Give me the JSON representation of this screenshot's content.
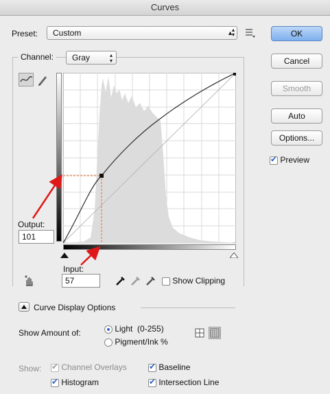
{
  "window": {
    "title": "Curves"
  },
  "preset": {
    "label": "Preset:",
    "value": "Custom"
  },
  "channel": {
    "label": "Channel:",
    "value": "Gray"
  },
  "buttons": {
    "ok": "OK",
    "cancel": "Cancel",
    "smooth": "Smooth",
    "auto": "Auto",
    "options": "Options..."
  },
  "preview": {
    "label": "Preview",
    "checked": true
  },
  "output": {
    "label": "Output:",
    "value": "101"
  },
  "input": {
    "label": "Input:",
    "value": "57"
  },
  "show_clipping": {
    "label": "Show Clipping",
    "checked": false
  },
  "curve_display_options": {
    "label": "Curve Display Options"
  },
  "show_amount": {
    "label": "Show Amount of:",
    "options": [
      {
        "label": "Light  (0-255)",
        "selected": true
      },
      {
        "label": "Pigment/Ink %",
        "selected": false
      }
    ]
  },
  "show": {
    "label": "Show:",
    "items": [
      {
        "label": "Channel Overlays",
        "checked": true,
        "enabled": false
      },
      {
        "label": "Baseline",
        "checked": true,
        "enabled": true
      },
      {
        "label": "Histogram",
        "checked": true,
        "enabled": true
      },
      {
        "label": "Intersection Line",
        "checked": true,
        "enabled": true
      }
    ]
  },
  "colors": {
    "annotation_arrow": "#e01818",
    "guide_dotted": "#e8702a",
    "ok_button": "#7eb0ee"
  },
  "icons": [
    "curve-edit-icon",
    "pencil-icon",
    "preset-menu-icon",
    "hand-adjust-icon",
    "black-eyedropper-icon",
    "gray-eyedropper-icon",
    "white-eyedropper-icon",
    "simple-grid-icon",
    "detailed-grid-icon",
    "disclosure-icon"
  ]
}
